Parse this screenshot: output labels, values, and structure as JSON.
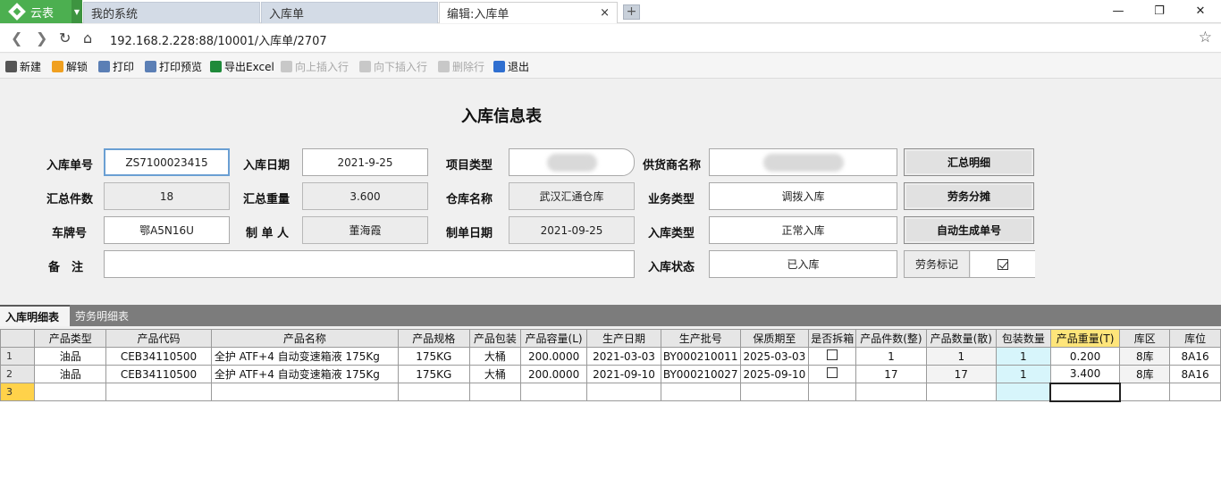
{
  "tabs": {
    "brand": "云表",
    "items": [
      "我的系统",
      "入库单",
      "编辑:入库单"
    ],
    "close": "×",
    "new_tab": "+"
  },
  "window": {
    "minimize": "—",
    "restore": "❐",
    "close": "✕"
  },
  "address": {
    "url": "192.168.2.228:88/10001/入库单/2707"
  },
  "toolbar": {
    "items": [
      {
        "label": "新建",
        "color": "#555555",
        "enabled": true
      },
      {
        "label": "解锁",
        "color": "#f0a020",
        "enabled": true
      },
      {
        "label": "打印",
        "color": "#5b7fb5",
        "enabled": true
      },
      {
        "label": "打印预览",
        "color": "#5b7fb5",
        "enabled": true
      },
      {
        "label": "导出Excel",
        "color": "#1f8a3a",
        "enabled": true
      },
      {
        "label": "向上插入行",
        "color": "#c8c8c8",
        "enabled": false
      },
      {
        "label": "向下插入行",
        "color": "#c8c8c8",
        "enabled": false
      },
      {
        "label": "删除行",
        "color": "#c8c8c8",
        "enabled": false
      },
      {
        "label": "退出",
        "color": "#2f6fd0",
        "enabled": true
      }
    ]
  },
  "form": {
    "title": "入库信息表",
    "labels": {
      "order_no": "入库单号",
      "date": "入库日期",
      "project_type": "项目类型",
      "supplier": "供货商名称",
      "total_pieces": "汇总件数",
      "total_weight": "汇总重量",
      "warehouse": "仓库名称",
      "biz_type": "业务类型",
      "plate": "车牌号",
      "maker": "制 单 人",
      "make_date": "制单日期",
      "in_type": "入库类型",
      "remark": "备　注",
      "status": "入库状态"
    },
    "values": {
      "order_no": "ZS7100023415",
      "date": "2021-9-25",
      "project_type": "",
      "supplier": "",
      "total_pieces": "18",
      "total_weight": "3.600",
      "warehouse": "武汉汇通仓库",
      "biz_type": "调拨入库",
      "plate": "鄂A5N16U",
      "maker": "董海霞",
      "make_date": "2021-09-25",
      "in_type": "正常入库",
      "remark": "",
      "status": "已入库"
    },
    "buttons": {
      "summary": "汇总明细",
      "labor_split": "劳务分摊",
      "auto_no": "自动生成单号"
    },
    "labor_flag_label": "劳务标记",
    "labor_flag_checked": true
  },
  "detail_tabs": [
    "入库明细表",
    "劳务明细表"
  ],
  "grid": {
    "columns": [
      "产品类型",
      "产品代码",
      "产品名称",
      "产品规格",
      "产品包装",
      "产品容量(L)",
      "生产日期",
      "生产批号",
      "保质期至",
      "是否拆箱",
      "产品件数(整)",
      "产品数量(散)",
      "包装数量",
      "产品重量(T)",
      "库区",
      "库位"
    ],
    "rows": [
      {
        "rn": "1",
        "cells": [
          "油品",
          "CEB34110500",
          "全护 ATF+4 自动变速箱液 175Kg",
          "175KG",
          "大桶",
          "200.0000",
          "2021-03-03",
          "BY000210011",
          "2025-03-03",
          "",
          "1",
          "1",
          "1",
          "0.200",
          "8库",
          "8A16"
        ],
        "unpack": false
      },
      {
        "rn": "2",
        "cells": [
          "油品",
          "CEB34110500",
          "全护 ATF+4 自动变速箱液 175Kg",
          "175KG",
          "大桶",
          "200.0000",
          "2021-09-10",
          "BY000210027",
          "2025-09-10",
          "",
          "17",
          "17",
          "1",
          "3.400",
          "8库",
          "8A16"
        ],
        "unpack": false
      },
      {
        "rn": "3",
        "cells": [
          "",
          "",
          "",
          "",
          "",
          "",
          "",
          "",
          "",
          "",
          "",
          "",
          "",
          "",
          "",
          ""
        ],
        "unpack": null
      }
    ]
  }
}
